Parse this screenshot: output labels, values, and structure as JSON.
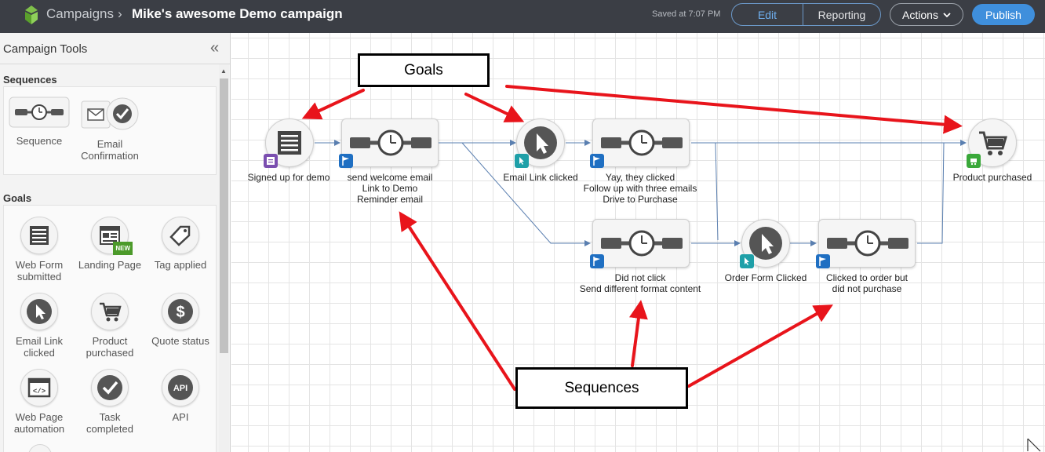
{
  "topbar": {
    "breadcrumb_root": "Campaigns",
    "separator": "›",
    "campaign_title": "Mike's awesome Demo campaign",
    "saved_status": "Saved at 7:07 PM",
    "tab_edit": "Edit",
    "tab_reporting": "Reporting",
    "actions_label": "Actions",
    "publish_label": "Publish"
  },
  "sidebar": {
    "title": "Campaign Tools",
    "sequences_label": "Sequences",
    "goals_label": "Goals",
    "sequence_tools": [
      {
        "label": "Sequence",
        "icon": "sequence-timer-icon"
      },
      {
        "label": "Email Confirmation",
        "icon": "email-check-icon"
      }
    ],
    "goal_tools": [
      {
        "label": "Web Form submitted",
        "icon": "web-form-icon"
      },
      {
        "label": "Landing Page",
        "icon": "landing-page-icon",
        "badge": "NEW"
      },
      {
        "label": "Tag applied",
        "icon": "tag-icon"
      },
      {
        "label": "Email Link clicked",
        "icon": "cursor-icon"
      },
      {
        "label": "Product purchased",
        "icon": "cart-icon"
      },
      {
        "label": "Quote status",
        "icon": "dollar-icon"
      },
      {
        "label": "Web Page automation",
        "icon": "code-icon"
      },
      {
        "label": "Task completed",
        "icon": "check-icon"
      },
      {
        "label": "API",
        "icon": "api-icon"
      }
    ]
  },
  "canvas": {
    "goals": {
      "signed_up": "Signed up for demo",
      "email_link": "Email Link clicked",
      "product_purchased": "Product purchased",
      "order_form": "Order Form Clicked"
    },
    "sequences": {
      "welcome": [
        "send welcome email",
        "Link to Demo",
        "Reminder email"
      ],
      "followup": [
        "Yay, they clicked",
        "Follow up with three emails",
        "Drive to Purchase"
      ],
      "not_click": [
        "Did not click",
        "Send different format content"
      ],
      "not_purchase": [
        "Clicked to order but",
        "did not purchase"
      ]
    },
    "callouts": {
      "goals": "Goals",
      "sequences": "Sequences"
    },
    "colors": {
      "arrow": "#e8141b",
      "connector": "#5a7fb0",
      "flag": "#1f6fc2",
      "publish": "#3f8fdc"
    }
  }
}
